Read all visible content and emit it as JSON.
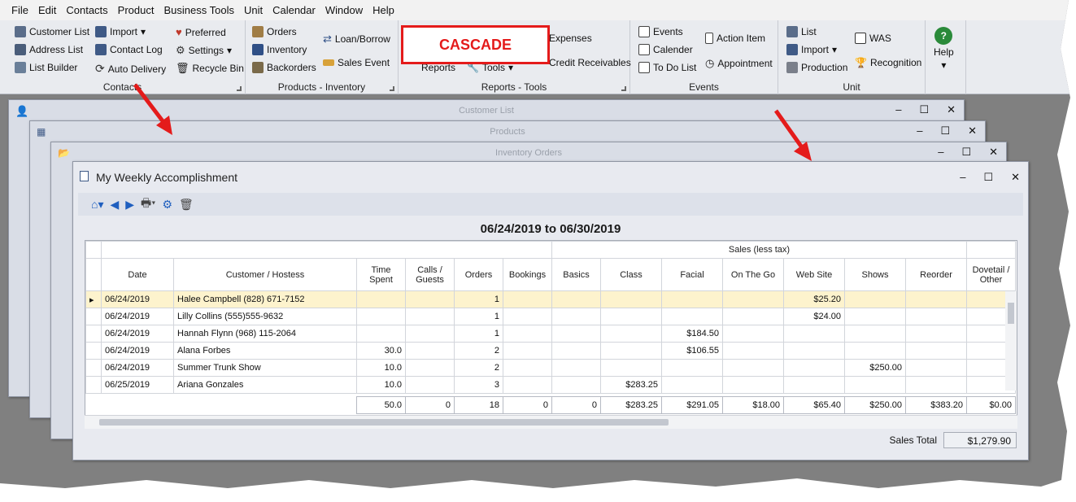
{
  "menu": [
    "File",
    "Edit",
    "Contacts",
    "Product",
    "Business Tools",
    "Unit",
    "Calendar",
    "Window",
    "Help"
  ],
  "ribbon": {
    "contacts": {
      "label": "Contacts",
      "items": [
        "Customer List",
        "Address List",
        "List Builder",
        "Import",
        "Contact Log",
        "Auto Delivery",
        "Preferred",
        "Settings",
        "Recycle Bin"
      ]
    },
    "products_inventory": {
      "label": "Products - Inventory",
      "items": [
        "Orders",
        "Inventory",
        "Backorders",
        "Loan/Borrow",
        "Sales Event"
      ]
    },
    "reports_tools": {
      "label": "Reports - Tools",
      "items": [
        "Reports",
        "Tools",
        "Expenses",
        "Credit Receivables"
      ]
    },
    "events": {
      "label": "Events",
      "items": [
        "Events",
        "Calender",
        "To Do List",
        "Action Item",
        "Appointment"
      ]
    },
    "unit": {
      "label": "Unit",
      "items": [
        "List",
        "Import",
        "Production",
        "WAS",
        "Recognition"
      ]
    },
    "help": {
      "label": "Help"
    }
  },
  "cascade_label": "CASCADE",
  "windows": {
    "customer_list": "Customer List",
    "products": "Products",
    "inventory_orders": "Inventory Orders",
    "main": "My Weekly Accomplishment"
  },
  "date_range": "06/24/2019 to 06/30/2019",
  "grid": {
    "band_label": "Sales (less tax)",
    "columns": [
      "Date",
      "Customer / Hostess",
      "Time Spent",
      "Calls / Guests",
      "Orders",
      "Bookings",
      "Basics",
      "Class",
      "Facial",
      "On The Go",
      "Web Site",
      "Shows",
      "Reorder",
      "Dovetail / Other"
    ],
    "rows": [
      [
        "06/24/2019",
        "Halee Campbell (828) 671-7152",
        "",
        "",
        "1",
        "",
        "",
        "",
        "",
        "",
        "$25.20",
        "",
        "",
        ""
      ],
      [
        "06/24/2019",
        "Lilly Collins (555)555-9632",
        "",
        "",
        "1",
        "",
        "",
        "",
        "",
        "",
        "$24.00",
        "",
        "",
        ""
      ],
      [
        "06/24/2019",
        "Hannah Flynn (968) 115-2064",
        "",
        "",
        "1",
        "",
        "",
        "",
        "$184.50",
        "",
        "",
        "",
        "",
        ""
      ],
      [
        "06/24/2019",
        "Alana Forbes",
        "30.0",
        "",
        "2",
        "",
        "",
        "",
        "$106.55",
        "",
        "",
        "",
        "",
        ""
      ],
      [
        "06/24/2019",
        "Summer Trunk Show",
        "10.0",
        "",
        "2",
        "",
        "",
        "",
        "",
        "",
        "",
        "$250.00",
        "",
        ""
      ],
      [
        "06/25/2019",
        "Ariana Gonzales",
        "10.0",
        "",
        "3",
        "",
        "",
        "$283.25",
        "",
        "",
        "",
        "",
        "",
        ""
      ]
    ],
    "totals": [
      "50.0",
      "0",
      "18",
      "0",
      "0",
      "$283.25",
      "$291.05",
      "$18.00",
      "$65.40",
      "$250.00",
      "$383.20",
      "$0.00"
    ]
  },
  "sales_total": {
    "label": "Sales Total",
    "value": "$1,279.90"
  },
  "colors": {
    "accent_red": "#e41b1b",
    "selected_row": "#fdf3cd",
    "toolbar_blue": "#1f5fbf"
  }
}
